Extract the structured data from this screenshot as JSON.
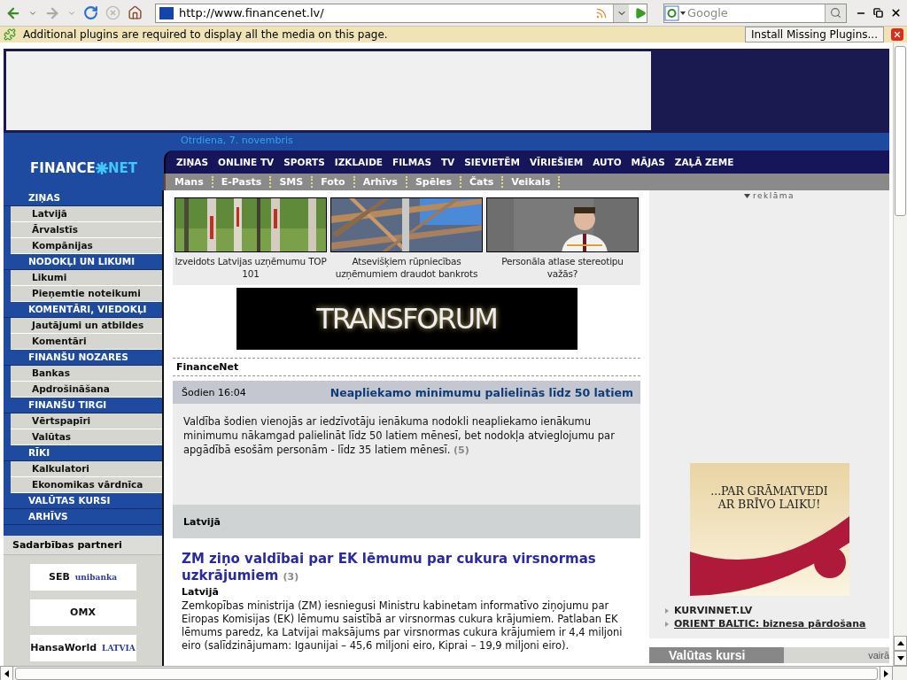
{
  "browser": {
    "url": "http://www.financenet.lv/",
    "search_placeholder": "Google"
  },
  "notification": {
    "message": "Additional plugins are required to display all the media on this page.",
    "button": "Install Missing Plugins..."
  },
  "site": {
    "date": "Otrdiena, 7. novembris",
    "logo_left": "FINANCE",
    "logo_right": "NET"
  },
  "top_nav": [
    "ZIŅAS",
    "ONLINE TV",
    "SPORTS",
    "IZKLAIDE",
    "FILMAS",
    "TV",
    "SIEVIETĒM",
    "VĪRIEŠIEM",
    "AUTO",
    "MĀJAS",
    "ZAĻĀ ZEME"
  ],
  "sub_nav": [
    "Mans",
    "E-Pasts",
    "SMS",
    "Foto",
    "Arhīvs",
    "Spēles",
    "Čats",
    "Veikals"
  ],
  "sidebar": [
    {
      "kind": "header",
      "label": "ZIŅAS"
    },
    {
      "kind": "item",
      "label": "Latvijā"
    },
    {
      "kind": "item",
      "label": "Ārvalstīs"
    },
    {
      "kind": "item",
      "label": "Kompānijas"
    },
    {
      "kind": "header",
      "label": "NODOKĻI UN LIKUMI"
    },
    {
      "kind": "item",
      "label": "Likumi"
    },
    {
      "kind": "item",
      "label": "Pieņemtie noteikumi"
    },
    {
      "kind": "header",
      "label": "KOMENTĀRI, VIEDOKĻI"
    },
    {
      "kind": "item",
      "label": "Jautājumi un atbildes"
    },
    {
      "kind": "item",
      "label": "Komentāri"
    },
    {
      "kind": "header",
      "label": "FINANŠU NOZARES"
    },
    {
      "kind": "item",
      "label": "Bankas"
    },
    {
      "kind": "item",
      "label": "Apdrošināšana"
    },
    {
      "kind": "header",
      "label": "FINANŠU TIRGI"
    },
    {
      "kind": "item",
      "label": "Vērtspapīri"
    },
    {
      "kind": "item",
      "label": "Valūtas"
    },
    {
      "kind": "header",
      "label": "RĪKI"
    },
    {
      "kind": "item",
      "label": "Kalkulatori"
    },
    {
      "kind": "item",
      "label": "Ekonomikas vārdnīca"
    },
    {
      "kind": "header",
      "label": "VALŪTAS KURSI"
    },
    {
      "kind": "header",
      "label": "ARHĪVS"
    }
  ],
  "partners": {
    "title": "Sadarbības partneri",
    "logos": [
      [
        "SEB",
        "unibanka"
      ],
      [
        "OMX"
      ],
      [
        "HansaWorld",
        "LATVIA"
      ]
    ]
  },
  "featured": [
    {
      "kind": "picture",
      "caption": "Izveidots Latvijas uzņēmumu TOP 101"
    },
    {
      "kind": "picture",
      "caption": "Atsevišķiem rūpniecības uzņēmumiem draudot bankrots"
    },
    {
      "kind": "picture",
      "caption": "Personāla atlase stereotipu važās?"
    }
  ],
  "banner": "TRANSFORUM",
  "section_title": "FinanceNet",
  "lead": {
    "time": "Šodien 16:04",
    "headline": "Neapliekamo minimumu palielinās līdz 50 latiem",
    "body": "Valdība šodien vienojās ar iedzīvotāju ienākuma nodokli neapliekamo ienākumu minimumu nākamgad palielināt līdz 50 latiem mēnesī, bet nodokļa atvieglojumu par apgādībā esošām personām - līdz 35 latiem mēnesī.",
    "comments": "(5)"
  },
  "category": "Latvijā",
  "article": {
    "title": "ZM ziņo valdībai par EK lēmumu par cukura virsnormas uzkrājumiem",
    "comments": "(3)",
    "category": "Latvijā",
    "body": "Zemkopības ministrija (ZM) iesniegusi Ministru kabinetam informatīvo ziņojumu par Eiropas Komisijas (EK) lēmumu saistībā ar virsnormas cukura krājumiem. Patlaban EK lēmums paredz, ka Latvijai maksājums par virsnormas cukura krājumiem ir 4,4 miljoni eiro (salīdzinājumam: Igaunijai – 45,6 miljoni eiro, Kiprai – 19,9 miljoni eiro)."
  },
  "ad": {
    "label": "reklāma",
    "lines": [
      "...PAR GRĀMATVEDI",
      "AR BRĪVO LAIKU!"
    ]
  },
  "ad_links": [
    {
      "label": "KURVINNET.LV",
      "underlined": false
    },
    {
      "label": "ORIENT BALTIC: biznesa pārdošana",
      "underlined": true
    }
  ],
  "rates": {
    "title": "Valūtas kursi",
    "more": "vairā"
  }
}
